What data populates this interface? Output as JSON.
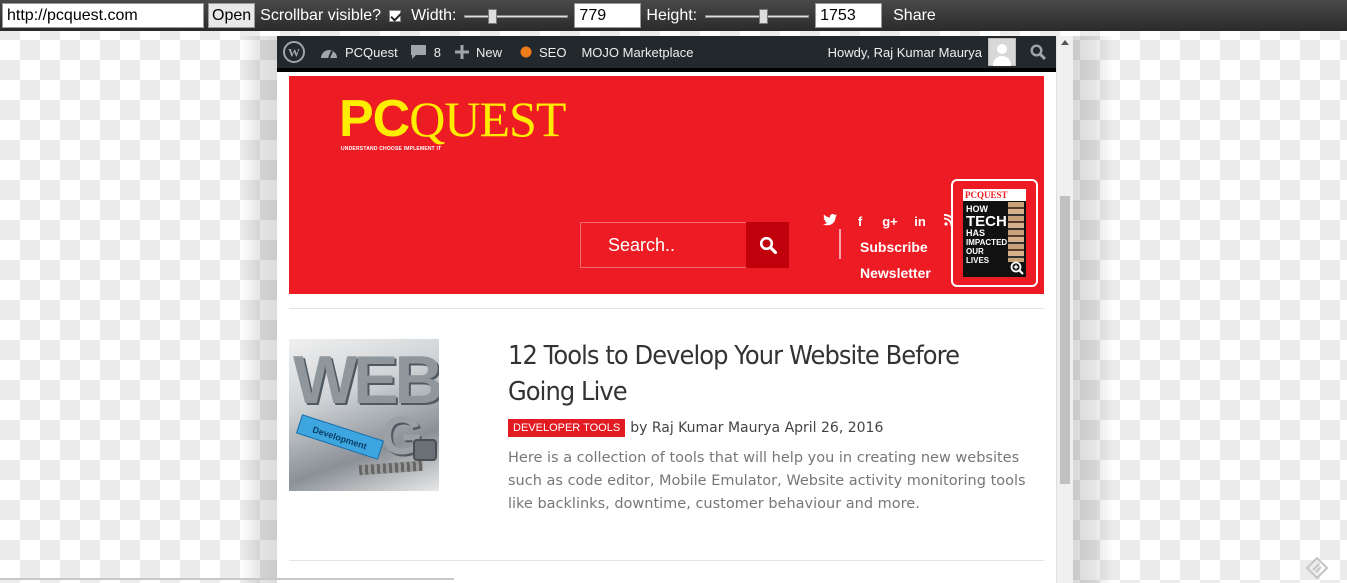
{
  "toolbar": {
    "url_value": "http://pcquest.com",
    "open_label": "Open",
    "scrollbar_label": "Scrollbar visible?",
    "scrollbar_checked": true,
    "width_label": "Width:",
    "width_value": "779",
    "height_label": "Height:",
    "height_value": "1753",
    "share_label": "Share"
  },
  "adminbar": {
    "site_name": "PCQuest",
    "comments_count": "8",
    "new_label": "New",
    "seo_label": "SEO",
    "marketplace_label": "MOJO Marketplace",
    "howdy": "Howdy, Raj Kumar Maurya"
  },
  "header": {
    "logo_pc": "PC",
    "logo_quest": "QUEST",
    "logo_tagline": "UNDERSTAND CHOOSE IMPLEMENT IT",
    "search_placeholder": "Search..",
    "subscribe_line1": "Subscribe",
    "subscribe_line2": "Newsletter",
    "social_icons": [
      "twitter-icon",
      "facebook-icon",
      "google-plus-icon",
      "linkedin-icon",
      "rss-icon"
    ],
    "magazine": {
      "masthead": "PCQUEST",
      "headline_line1": "HOW",
      "headline_line2": "TECH",
      "headline_line3": "HAS",
      "headline_line4": "IMPACTED",
      "headline_line5": "OUR LIVES"
    },
    "brand_color": "#ed1b24",
    "logo_color": "#ffed00"
  },
  "article": {
    "thumb_text_1": "WEB",
    "thumb_text_2": "G",
    "thumb_tag": "Development",
    "title": "12 Tools to Develop Your Website Before Going Live",
    "category": "DEVELOPER TOOLS",
    "by": "by",
    "author": "Raj Kumar Maurya",
    "date": "April 26, 2016",
    "excerpt": "Here is a collection of tools that will help you in creating new websites such as code editor, Mobile Emulator, Website activity monitoring tools like  backlinks, downtime, customer behaviour and more."
  }
}
